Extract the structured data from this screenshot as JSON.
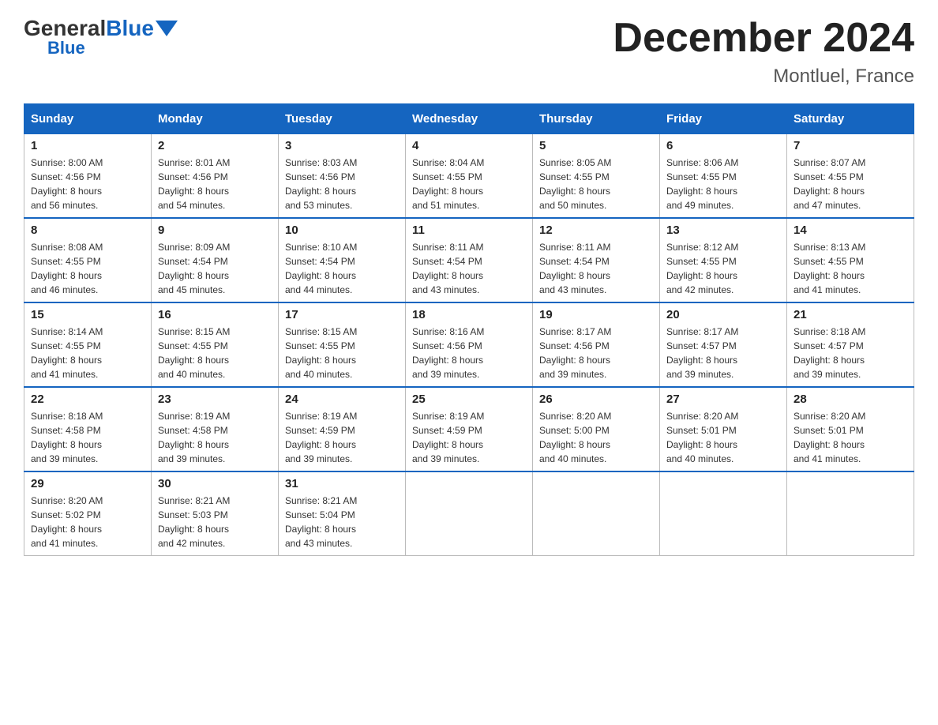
{
  "logo": {
    "general": "General",
    "blue": "Blue",
    "blue_label": "Blue"
  },
  "header": {
    "month_title": "December 2024",
    "location": "Montluel, France"
  },
  "days_of_week": [
    "Sunday",
    "Monday",
    "Tuesday",
    "Wednesday",
    "Thursday",
    "Friday",
    "Saturday"
  ],
  "weeks": [
    [
      {
        "day": "1",
        "sunrise": "8:00 AM",
        "sunset": "4:56 PM",
        "daylight": "8 hours and 56 minutes."
      },
      {
        "day": "2",
        "sunrise": "8:01 AM",
        "sunset": "4:56 PM",
        "daylight": "8 hours and 54 minutes."
      },
      {
        "day": "3",
        "sunrise": "8:03 AM",
        "sunset": "4:56 PM",
        "daylight": "8 hours and 53 minutes."
      },
      {
        "day": "4",
        "sunrise": "8:04 AM",
        "sunset": "4:55 PM",
        "daylight": "8 hours and 51 minutes."
      },
      {
        "day": "5",
        "sunrise": "8:05 AM",
        "sunset": "4:55 PM",
        "daylight": "8 hours and 50 minutes."
      },
      {
        "day": "6",
        "sunrise": "8:06 AM",
        "sunset": "4:55 PM",
        "daylight": "8 hours and 49 minutes."
      },
      {
        "day": "7",
        "sunrise": "8:07 AM",
        "sunset": "4:55 PM",
        "daylight": "8 hours and 47 minutes."
      }
    ],
    [
      {
        "day": "8",
        "sunrise": "8:08 AM",
        "sunset": "4:55 PM",
        "daylight": "8 hours and 46 minutes."
      },
      {
        "day": "9",
        "sunrise": "8:09 AM",
        "sunset": "4:54 PM",
        "daylight": "8 hours and 45 minutes."
      },
      {
        "day": "10",
        "sunrise": "8:10 AM",
        "sunset": "4:54 PM",
        "daylight": "8 hours and 44 minutes."
      },
      {
        "day": "11",
        "sunrise": "8:11 AM",
        "sunset": "4:54 PM",
        "daylight": "8 hours and 43 minutes."
      },
      {
        "day": "12",
        "sunrise": "8:11 AM",
        "sunset": "4:54 PM",
        "daylight": "8 hours and 43 minutes."
      },
      {
        "day": "13",
        "sunrise": "8:12 AM",
        "sunset": "4:55 PM",
        "daylight": "8 hours and 42 minutes."
      },
      {
        "day": "14",
        "sunrise": "8:13 AM",
        "sunset": "4:55 PM",
        "daylight": "8 hours and 41 minutes."
      }
    ],
    [
      {
        "day": "15",
        "sunrise": "8:14 AM",
        "sunset": "4:55 PM",
        "daylight": "8 hours and 41 minutes."
      },
      {
        "day": "16",
        "sunrise": "8:15 AM",
        "sunset": "4:55 PM",
        "daylight": "8 hours and 40 minutes."
      },
      {
        "day": "17",
        "sunrise": "8:15 AM",
        "sunset": "4:55 PM",
        "daylight": "8 hours and 40 minutes."
      },
      {
        "day": "18",
        "sunrise": "8:16 AM",
        "sunset": "4:56 PM",
        "daylight": "8 hours and 39 minutes."
      },
      {
        "day": "19",
        "sunrise": "8:17 AM",
        "sunset": "4:56 PM",
        "daylight": "8 hours and 39 minutes."
      },
      {
        "day": "20",
        "sunrise": "8:17 AM",
        "sunset": "4:57 PM",
        "daylight": "8 hours and 39 minutes."
      },
      {
        "day": "21",
        "sunrise": "8:18 AM",
        "sunset": "4:57 PM",
        "daylight": "8 hours and 39 minutes."
      }
    ],
    [
      {
        "day": "22",
        "sunrise": "8:18 AM",
        "sunset": "4:58 PM",
        "daylight": "8 hours and 39 minutes."
      },
      {
        "day": "23",
        "sunrise": "8:19 AM",
        "sunset": "4:58 PM",
        "daylight": "8 hours and 39 minutes."
      },
      {
        "day": "24",
        "sunrise": "8:19 AM",
        "sunset": "4:59 PM",
        "daylight": "8 hours and 39 minutes."
      },
      {
        "day": "25",
        "sunrise": "8:19 AM",
        "sunset": "4:59 PM",
        "daylight": "8 hours and 39 minutes."
      },
      {
        "day": "26",
        "sunrise": "8:20 AM",
        "sunset": "5:00 PM",
        "daylight": "8 hours and 40 minutes."
      },
      {
        "day": "27",
        "sunrise": "8:20 AM",
        "sunset": "5:01 PM",
        "daylight": "8 hours and 40 minutes."
      },
      {
        "day": "28",
        "sunrise": "8:20 AM",
        "sunset": "5:01 PM",
        "daylight": "8 hours and 41 minutes."
      }
    ],
    [
      {
        "day": "29",
        "sunrise": "8:20 AM",
        "sunset": "5:02 PM",
        "daylight": "8 hours and 41 minutes."
      },
      {
        "day": "30",
        "sunrise": "8:21 AM",
        "sunset": "5:03 PM",
        "daylight": "8 hours and 42 minutes."
      },
      {
        "day": "31",
        "sunrise": "8:21 AM",
        "sunset": "5:04 PM",
        "daylight": "8 hours and 43 minutes."
      },
      null,
      null,
      null,
      null
    ]
  ],
  "labels": {
    "sunrise": "Sunrise:",
    "sunset": "Sunset:",
    "daylight": "Daylight:"
  }
}
